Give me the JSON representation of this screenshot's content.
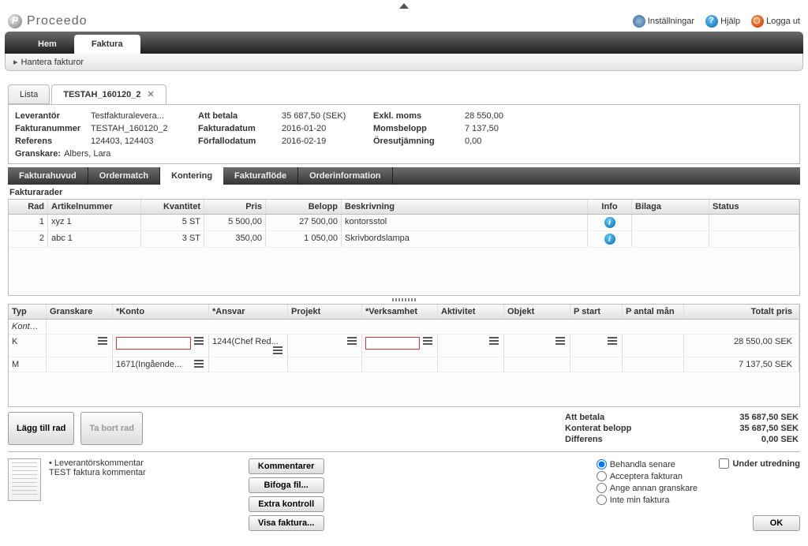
{
  "app_name": "Proceedo",
  "tools": {
    "settings": "Inställningar",
    "help": "Hjälp",
    "logout": "Logga ut"
  },
  "nav": {
    "home": "Hem",
    "invoice": "Faktura",
    "breadcrumb": "Hantera fakturor"
  },
  "doc_tabs": {
    "list": "Lista",
    "current": "TESTAH_160120_2"
  },
  "info": {
    "supplier_lbl": "Leverantör",
    "supplier": "Testfakturalevera...",
    "invoiceno_lbl": "Fakturanummer",
    "invoiceno": "TESTAH_160120_2",
    "reference_lbl": "Referens",
    "reference": "124403, 124403",
    "topay_lbl": "Att betala",
    "topay": "35 687,50 (SEK)",
    "invdate_lbl": "Fakturadatum",
    "invdate": "2016-01-20",
    "duedate_lbl": "Förfallodatum",
    "duedate": "2016-02-19",
    "exvat_lbl": "Exkl. moms",
    "exvat": "28 550,00",
    "vat_lbl": "Momsbelopp",
    "vat": "7 137,50",
    "rounding_lbl": "Öresutjämning",
    "rounding": "0,00",
    "reviewer_lbl": "Granskare:",
    "reviewer": "Albers, Lara"
  },
  "section_tabs": {
    "head": "Fakturahuvud",
    "ordermatch": "Ordermatch",
    "accounting": "Kontering",
    "flow": "Fakturaflöde",
    "orderinfo": "Orderinformation"
  },
  "upper": {
    "title": "Fakturarader",
    "cols": {
      "row": "Rad",
      "artno": "Artikelnummer",
      "qty": "Kvantitet",
      "price": "Pris",
      "amount": "Belopp",
      "desc": "Beskrivning",
      "info": "Info",
      "attach": "Bilaga",
      "status": "Status"
    },
    "rows": [
      {
        "row": "1",
        "artno": "xyz 1",
        "qty": "5 ST",
        "price": "5 500,00",
        "amount": "27 500,00",
        "desc": "kontorsstol"
      },
      {
        "row": "2",
        "artno": "abc 1",
        "qty": "3 ST",
        "price": "350,00",
        "amount": "1 050,00",
        "desc": "Skrivbordslampa"
      }
    ]
  },
  "lower": {
    "cols": {
      "type": "Typ",
      "reviewer": "Granskare",
      "account": "*Konto",
      "resp": "*Ansvar",
      "project": "Projekt",
      "activity_area": "*Verksamhet",
      "activity": "Aktivitet",
      "object": "Objekt",
      "pstart": "P start",
      "pmonths": "P antal mån",
      "total": "Totalt pris"
    },
    "group": "Konteri...",
    "rows": [
      {
        "type": "K",
        "account": "",
        "resp": "1244(Chef Red...",
        "total": "28 550,00 SEK",
        "require_account": true,
        "require_area": true
      },
      {
        "type": "M",
        "account": "1671(Ingående...",
        "resp": "",
        "total": "7 137,50 SEK"
      }
    ]
  },
  "actions": {
    "addrow": "Lägg till rad",
    "delrow": "Ta bort rad"
  },
  "totals": {
    "topay_lbl": "Att betala",
    "topay": "35 687,50 SEK",
    "coded_lbl": "Konterat belopp",
    "coded": "35 687,50 SEK",
    "diff_lbl": "Differens",
    "diff": "0,00 SEK"
  },
  "footer": {
    "comment_title": "Leverantörskommentar",
    "comment_body": "TEST faktura kommentar",
    "btns": {
      "comments": "Kommentarer",
      "attach": "Bifoga fil...",
      "extra": "Extra kontroll",
      "show": "Visa faktura..."
    },
    "radios": {
      "later": "Behandla senare",
      "accept": "Acceptera fakturan",
      "assign": "Ange annan granskare",
      "notmine": "Inte min faktura"
    },
    "under_review": "Under utredning",
    "ok": "OK"
  }
}
